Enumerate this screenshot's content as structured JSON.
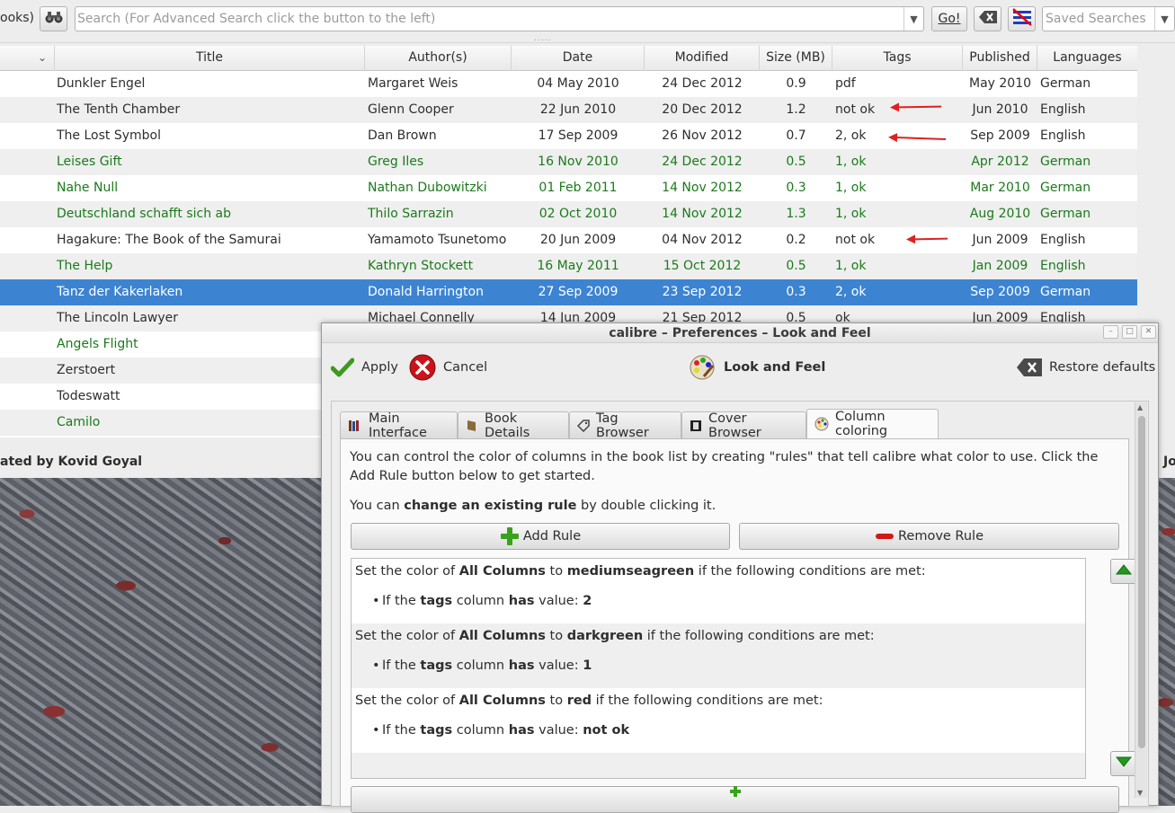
{
  "toolbar": {
    "partial_label": "ooks)",
    "search_placeholder": "Search (For Advanced Search click the button to the left)",
    "go_label": "Go!",
    "saved_searches_placeholder": "Saved Searches"
  },
  "table": {
    "columns": [
      "Title",
      "Author(s)",
      "Date",
      "Modified",
      "Size (MB)",
      "Tags",
      "Published",
      "Languages"
    ],
    "rows": [
      {
        "title": "Dunkler Engel",
        "author": "Margaret Weis",
        "date": "04 May 2010",
        "modified": "24 Dec 2012",
        "size": "0.9",
        "tags": "pdf",
        "published": "May 2010",
        "language": "German",
        "color": "default"
      },
      {
        "title": "The Tenth Chamber",
        "author": "Glenn Cooper",
        "date": "22 Jun 2010",
        "modified": "20 Dec 2012",
        "size": "1.2",
        "tags": "not ok",
        "published": "Jun 2010",
        "language": "English",
        "color": "default"
      },
      {
        "title": "The Lost Symbol",
        "author": "Dan Brown",
        "date": "17 Sep 2009",
        "modified": "26 Nov 2012",
        "size": "0.7",
        "tags": "2, ok",
        "published": "Sep 2009",
        "language": "English",
        "color": "default"
      },
      {
        "title": "Leises Gift",
        "author": "Greg Iles",
        "date": "16 Nov 2010",
        "modified": "24 Dec 2012",
        "size": "0.5",
        "tags": "1, ok",
        "published": "Apr 2012",
        "language": "German",
        "color": "green"
      },
      {
        "title": "Nahe Null",
        "author": "Nathan Dubowitzki",
        "date": "01 Feb 2011",
        "modified": "14 Nov 2012",
        "size": "0.3",
        "tags": "1, ok",
        "published": "Mar 2010",
        "language": "German",
        "color": "green"
      },
      {
        "title": "Deutschland schafft sich ab",
        "author": "Thilo Sarrazin",
        "date": "02 Oct 2010",
        "modified": "14 Nov 2012",
        "size": "1.3",
        "tags": "1, ok",
        "published": "Aug 2010",
        "language": "German",
        "color": "green"
      },
      {
        "title": "Hagakure: The Book of the Samurai",
        "author": "Yamamoto Tsunetomo",
        "date": "20 Jun 2009",
        "modified": "04 Nov 2012",
        "size": "0.2",
        "tags": "not ok",
        "published": "Jun 2009",
        "language": "English",
        "color": "default"
      },
      {
        "title": "The Help",
        "author": "Kathryn Stockett",
        "date": "16 May 2011",
        "modified": "15 Oct 2012",
        "size": "0.5",
        "tags": "1, ok",
        "published": "Jan 2009",
        "language": "English",
        "color": "green"
      },
      {
        "title": "Tanz der Kakerlaken",
        "author": "Donald Harrington",
        "date": "27 Sep 2009",
        "modified": "23 Sep 2012",
        "size": "0.3",
        "tags": "2, ok",
        "published": "Sep 2009",
        "language": "German",
        "color": "selected"
      },
      {
        "title": "The Lincoln Lawyer",
        "author": "Michael Connelly",
        "date": "14 Jun 2009",
        "modified": "21 Sep 2012",
        "size": "0.5",
        "tags": "ok",
        "published": "Jun 2009",
        "language": "English",
        "color": "default"
      },
      {
        "title": "Angels Flight",
        "color": "green"
      },
      {
        "title": "Zerstoert",
        "color": "default"
      },
      {
        "title": "Todeswatt",
        "color": "default"
      },
      {
        "title": "Camilo",
        "color": "green"
      }
    ]
  },
  "statusbar": {
    "left_text": "ated by Kovid Goyal",
    "right_text": "Jo"
  },
  "dialog": {
    "title": "calibre – Preferences – Look and Feel",
    "apply_label": "Apply",
    "cancel_label": "Cancel",
    "section_label": "Look and Feel",
    "restore_label": "Restore defaults",
    "tabs": [
      "Main Interface",
      "Book Details",
      "Tag Browser",
      "Cover Browser",
      "Column coloring"
    ],
    "intro_1": "You can control the color of columns in the book list by creating \"rules\" that tell calibre what color to use. Click the Add Rule button below to get started.",
    "intro_2_pre": "You can ",
    "intro_2_bold": "change an existing rule",
    "intro_2_post": " by double clicking it.",
    "add_rule_label": "Add Rule",
    "remove_rule_label": "Remove Rule",
    "rules": [
      {
        "pre": "Set the color of ",
        "cols": "All Columns",
        "mid": " to ",
        "color": "mediumseagreen",
        "post": " if the following conditions are met:",
        "c_pre": "If the ",
        "c_col": "tags",
        "c_mid": " column ",
        "c_op": "has",
        "c_mid2": " value: ",
        "c_val": "2"
      },
      {
        "pre": "Set the color of ",
        "cols": "All Columns",
        "mid": " to ",
        "color": "darkgreen",
        "post": " if the following conditions are met:",
        "c_pre": "If the ",
        "c_col": "tags",
        "c_mid": " column ",
        "c_op": "has",
        "c_mid2": " value: ",
        "c_val": "1"
      },
      {
        "pre": "Set the color of ",
        "cols": "All Columns",
        "mid": " to ",
        "color": "red",
        "post": " if the following conditions are met:",
        "c_pre": "If the ",
        "c_col": "tags",
        "c_mid": " column ",
        "c_op": "has",
        "c_mid2": " value: ",
        "c_val": "not ok"
      }
    ]
  },
  "colors": {
    "selection": "#3c84d2",
    "green_text": "#1a7a1a",
    "annotation_arrow": "#e02020"
  }
}
